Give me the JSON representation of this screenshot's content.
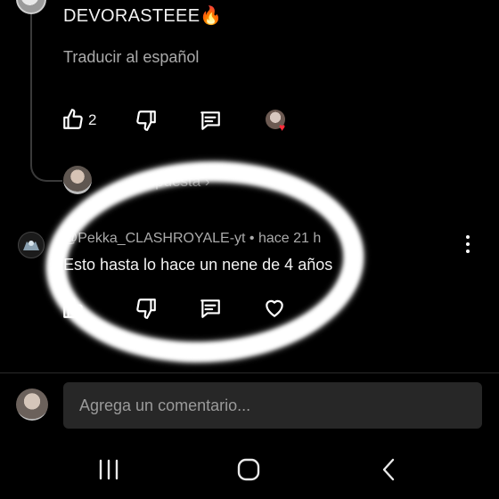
{
  "top_comment": {
    "text": "DEVORASTEEE🔥",
    "translate_label": "Traducir al español",
    "like_count": "2",
    "icons": [
      "thumbs-up-icon",
      "thumbs-down-icon",
      "reply-icon",
      "creator-heart-icon"
    ]
  },
  "replies_link": {
    "label": "...puesta ›"
  },
  "comment": {
    "author": "@Pekka_CLASHROYALE-yt",
    "separator": "•",
    "time": "hace 21 h",
    "text": "Esto hasta lo hace un nene de 4 años",
    "icons": [
      "thumbs-up-icon",
      "thumbs-down-icon",
      "reply-icon",
      "heart-icon",
      "more-vert-icon"
    ]
  },
  "composer": {
    "placeholder": "Agrega un comentario..."
  },
  "system_nav": {
    "icons": [
      "recents-icon",
      "home-icon",
      "back-icon"
    ]
  },
  "colors": {
    "background": "#000000",
    "input_bg": "#272727",
    "secondary_text": "#aaaaaa",
    "highlight": "#ffffff",
    "creator_heart": "#ff2d3a"
  }
}
